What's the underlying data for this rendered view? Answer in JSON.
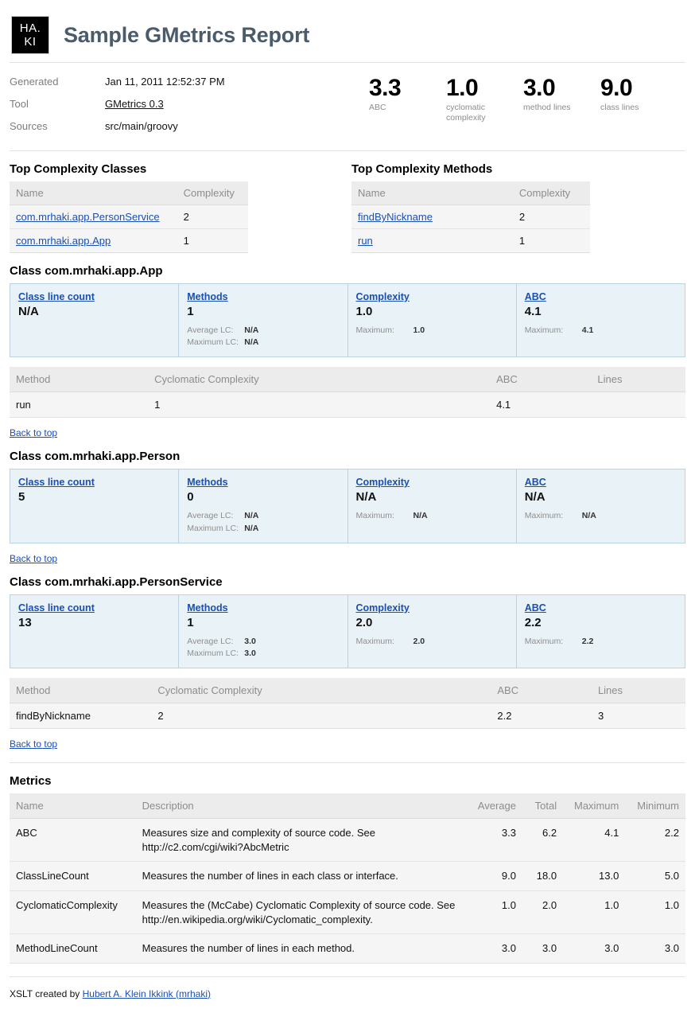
{
  "header": {
    "logo_line1": "HA.",
    "logo_line2": "KI",
    "title": "Sample GMetrics Report"
  },
  "summary": {
    "meta": [
      {
        "label": "Generated",
        "value": "Jan 11, 2011 12:52:37 PM",
        "link": false
      },
      {
        "label": "Tool",
        "value": "GMetrics 0.3",
        "link": true
      },
      {
        "label": "Sources",
        "value": "src/main/groovy",
        "link": false
      }
    ],
    "totals": [
      {
        "value": "3.3",
        "label": "ABC"
      },
      {
        "value": "1.0",
        "label": "cyclomatic complexity"
      },
      {
        "value": "3.0",
        "label": "method lines"
      },
      {
        "value": "9.0",
        "label": "class lines"
      }
    ]
  },
  "top_classes": {
    "heading": "Top Complexity Classes",
    "columns": [
      "Name",
      "Complexity"
    ],
    "rows": [
      {
        "name": "com.mrhaki.app.PersonService",
        "complexity": "2"
      },
      {
        "name": "com.mrhaki.app.App",
        "complexity": "1"
      }
    ]
  },
  "top_methods": {
    "heading": "Top Complexity Methods",
    "columns": [
      "Name",
      "Complexity"
    ],
    "rows": [
      {
        "name": "findByNickname",
        "complexity": "2"
      },
      {
        "name": "run",
        "complexity": "1"
      }
    ]
  },
  "method_table_columns": [
    "Method",
    "Cyclomatic Complexity",
    "ABC",
    "Lines"
  ],
  "back_to_top": "Back to top",
  "classes": [
    {
      "heading": "Class com.mrhaki.app.App",
      "cells": [
        {
          "title": "Class line count",
          "value": "N/A",
          "subs": []
        },
        {
          "title": "Methods",
          "value": "1",
          "subs": [
            {
              "key": "Average LC:",
              "val": "N/A"
            },
            {
              "key": "Maximum LC:",
              "val": "N/A"
            }
          ]
        },
        {
          "title": "Complexity",
          "value": "1.0",
          "subs": [
            {
              "key": "Maximum:",
              "val": "1.0"
            }
          ]
        },
        {
          "title": "ABC",
          "value": "4.1",
          "subs": [
            {
              "key": "Maximum:",
              "val": "4.1"
            }
          ]
        }
      ],
      "methods": [
        {
          "method": "run",
          "cyclomatic": "1",
          "abc": "4.1",
          "lines": ""
        }
      ]
    },
    {
      "heading": "Class com.mrhaki.app.Person",
      "cells": [
        {
          "title": "Class line count",
          "value": "5",
          "subs": []
        },
        {
          "title": "Methods",
          "value": "0",
          "subs": [
            {
              "key": "Average LC:",
              "val": "N/A"
            },
            {
              "key": "Maximum LC:",
              "val": "N/A"
            }
          ]
        },
        {
          "title": "Complexity",
          "value": "N/A",
          "subs": [
            {
              "key": "Maximum:",
              "val": "N/A"
            }
          ]
        },
        {
          "title": "ABC",
          "value": "N/A",
          "subs": [
            {
              "key": "Maximum:",
              "val": "N/A"
            }
          ]
        }
      ],
      "methods": []
    },
    {
      "heading": "Class com.mrhaki.app.PersonService",
      "cells": [
        {
          "title": "Class line count",
          "value": "13",
          "subs": []
        },
        {
          "title": "Methods",
          "value": "1",
          "subs": [
            {
              "key": "Average LC:",
              "val": "3.0"
            },
            {
              "key": "Maximum LC:",
              "val": "3.0"
            }
          ]
        },
        {
          "title": "Complexity",
          "value": "2.0",
          "subs": [
            {
              "key": "Maximum:",
              "val": "2.0"
            }
          ]
        },
        {
          "title": "ABC",
          "value": "2.2",
          "subs": [
            {
              "key": "Maximum:",
              "val": "2.2"
            }
          ]
        }
      ],
      "methods": [
        {
          "method": "findByNickname",
          "cyclomatic": "2",
          "abc": "2.2",
          "lines": "3"
        }
      ]
    }
  ],
  "metrics": {
    "heading": "Metrics",
    "columns": [
      "Name",
      "Description",
      "Average",
      "Total",
      "Maximum",
      "Minimum"
    ],
    "rows": [
      {
        "name": "ABC",
        "description": "Measures size and complexity of source code. See http://c2.com/cgi/wiki?AbcMetric",
        "average": "3.3",
        "total": "6.2",
        "maximum": "4.1",
        "minimum": "2.2"
      },
      {
        "name": "ClassLineCount",
        "description": "Measures the number of lines in each class or interface.",
        "average": "9.0",
        "total": "18.0",
        "maximum": "13.0",
        "minimum": "5.0"
      },
      {
        "name": "CyclomaticComplexity",
        "description": "Measures the (McCabe) Cyclomatic Complexity of source code. See http://en.wikipedia.org/wiki/Cyclomatic_complexity.",
        "average": "1.0",
        "total": "2.0",
        "maximum": "1.0",
        "minimum": "1.0"
      },
      {
        "name": "MethodLineCount",
        "description": "Measures the number of lines in each method.",
        "average": "3.0",
        "total": "3.0",
        "maximum": "3.0",
        "minimum": "3.0"
      }
    ]
  },
  "footer": {
    "prefix": "XSLT created by ",
    "author": "Hubert A. Klein Ikkink (mrhaki)"
  },
  "colors": {
    "title": "#4a5c6b",
    "link": "#1a4fb4",
    "box_bg": "#e9f2f7",
    "box_border": "#bcd2de",
    "table_header_bg": "#ececec",
    "table_row_bg": "#f5f5f5"
  }
}
